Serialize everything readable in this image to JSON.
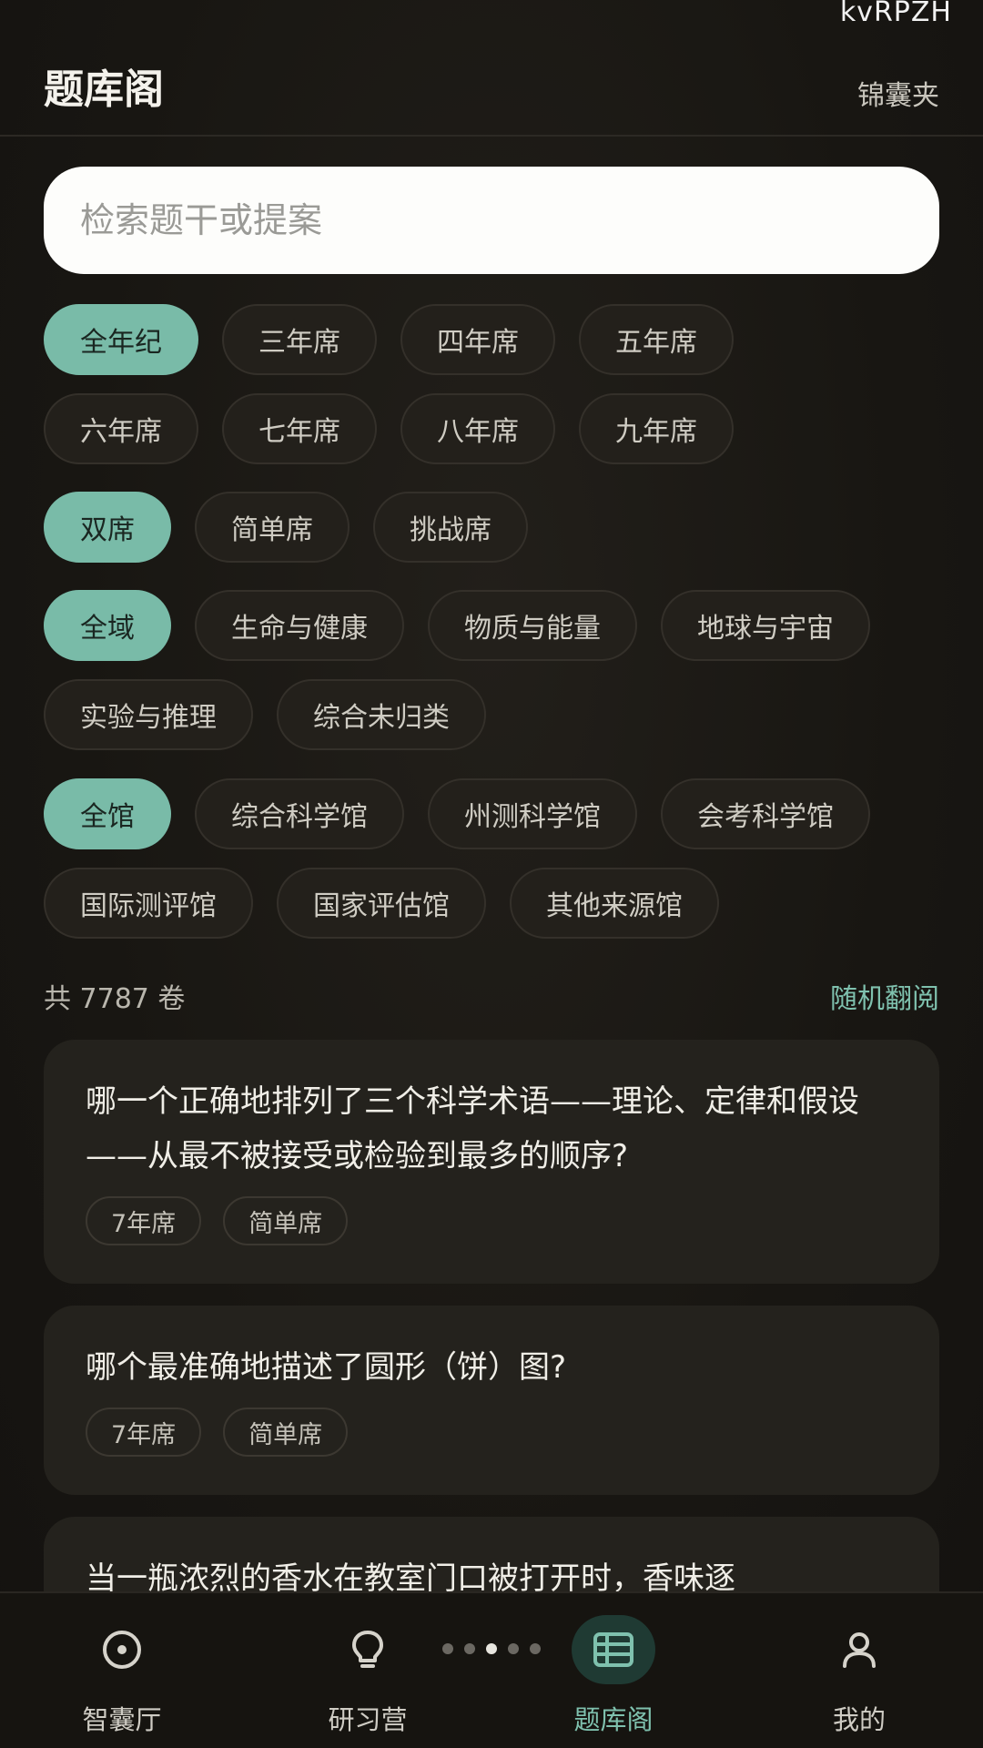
{
  "status": {
    "text": "kvRPZH"
  },
  "header": {
    "title": "题库阁",
    "link": "锦囊夹"
  },
  "search": {
    "placeholder": "检索题干或提案"
  },
  "filters": {
    "grades": [
      "全年纪",
      "三年席",
      "四年席",
      "五年席",
      "六年席",
      "七年席",
      "八年席",
      "九年席"
    ],
    "difficulty": [
      "双席",
      "简单席",
      "挑战席"
    ],
    "domains": [
      "全域",
      "生命与健康",
      "物质与能量",
      "地球与宇宙",
      "实验与推理",
      "综合未归类"
    ],
    "sources": [
      "全馆",
      "综合科学馆",
      "州测科学馆",
      "会考科学馆",
      "国际测评馆",
      "国家评估馆",
      "其他来源馆"
    ]
  },
  "results": {
    "count": "共 7787 卷",
    "random": "随机翻阅"
  },
  "questions": [
    {
      "title": "哪一个正确地排列了三个科学术语——理论、定律和假设——从最不被接受或检验到最多的顺序?",
      "tags": [
        "7年席",
        "简单席"
      ]
    },
    {
      "title": "哪个最准确地描述了圆形（饼）图?",
      "tags": [
        "7年席",
        "简单席"
      ]
    },
    {
      "title": "当一瓶浓烈的香水在教室门口被打开时，香味逐"
    }
  ],
  "nav": [
    {
      "label": "智囊厅",
      "icon": "target-icon"
    },
    {
      "label": "研习营",
      "icon": "lightbulb-icon"
    },
    {
      "label": "题库阁",
      "icon": "table-icon"
    },
    {
      "label": "我的",
      "icon": "user-icon"
    }
  ],
  "colors": {
    "accent": "#79bba8",
    "background": "#171511",
    "card": "#24221d"
  }
}
